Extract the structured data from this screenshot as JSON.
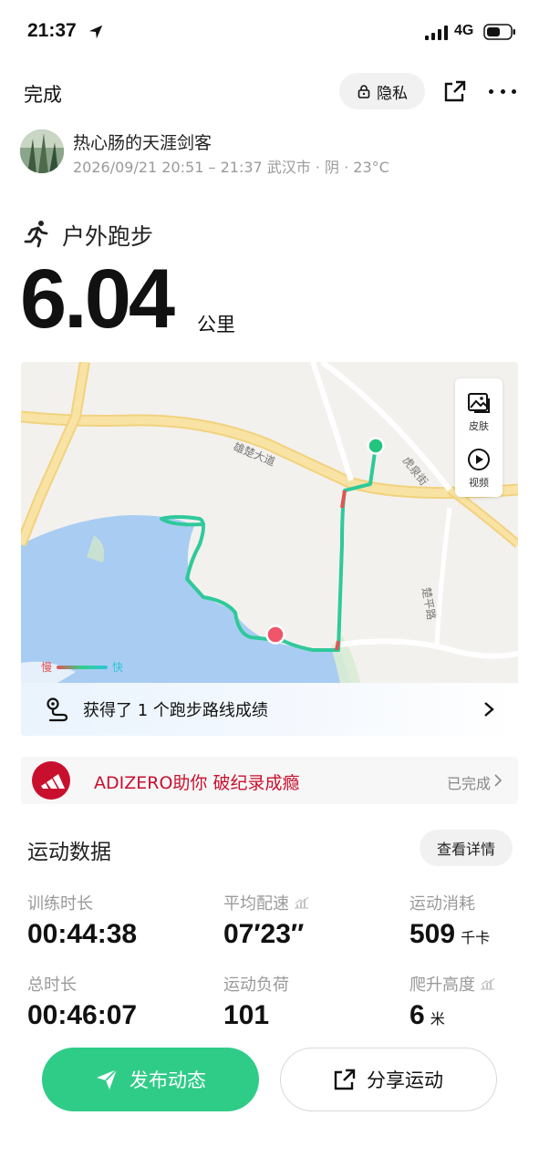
{
  "status_bar": {
    "time": "21:37",
    "network": "4G"
  },
  "header": {
    "done_label": "完成",
    "privacy_label": "隐私"
  },
  "user": {
    "name": "热心肠的天涯剑客",
    "meta": "2026/09/21 20:51 – 21:37 武汉市 · 阴 · 23°C"
  },
  "activity": {
    "type": "户外跑步",
    "distance": "6.04",
    "distance_unit": "公里"
  },
  "map": {
    "road_labels": [
      "雄楚大道",
      "虎泉街",
      "楚平路"
    ],
    "tools": [
      {
        "label": "皮肤",
        "icon": "image-icon"
      },
      {
        "label": "视频",
        "icon": "play-icon"
      }
    ],
    "speed_legend": {
      "slow": "慢",
      "fast": "快"
    },
    "route_record_text": "获得了 1 个跑步路线成绩",
    "colors": {
      "water": "#a9cdf2",
      "road": "#f7d98a",
      "route": "#2fc99a",
      "start": "#22c47e",
      "end": "#f0566a"
    }
  },
  "promo": {
    "text": "ADIZERO助你  破纪录成瘾",
    "status": "已完成",
    "brand_color": "#c8102e"
  },
  "sport_data": {
    "title": "运动数据",
    "detail_label": "查看详情",
    "stats": [
      {
        "label": "训练时长",
        "value": "00:44:38",
        "unit": ""
      },
      {
        "label": "平均配速",
        "value": "07′23″",
        "unit": ""
      },
      {
        "label": "运动消耗",
        "value": "509",
        "unit": "千卡"
      },
      {
        "label": "总时长",
        "value": "00:46:07",
        "unit": ""
      },
      {
        "label": "运动负荷",
        "value": "101",
        "unit": ""
      },
      {
        "label": "爬升高度",
        "value": "6",
        "unit": "米"
      }
    ]
  },
  "actions": {
    "publish_label": "发布动态",
    "share_label": "分享运动",
    "accent": "#2fcc88"
  }
}
